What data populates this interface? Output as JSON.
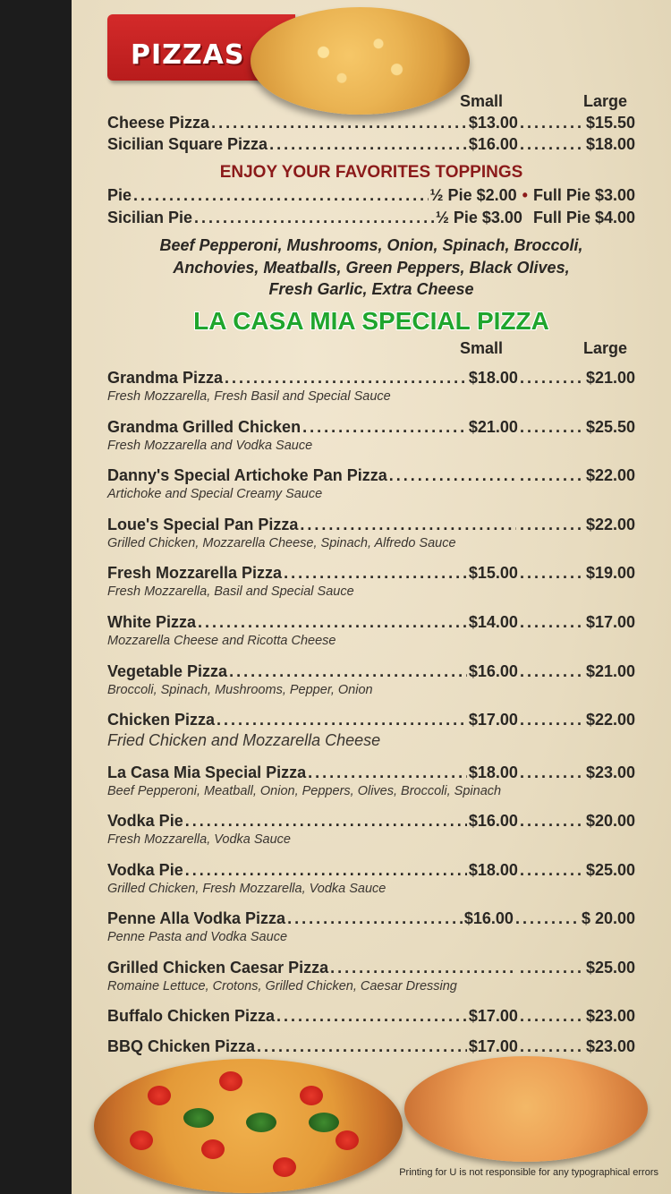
{
  "header": {
    "title": "PIZZAS"
  },
  "pizzas": {
    "col_small": "Small",
    "col_large": "Large",
    "items": [
      {
        "name": "Cheese Pizza",
        "small": "$13.00",
        "large": "$15.50"
      },
      {
        "name": "Sicilian Square Pizza",
        "small": "$16.00",
        "large": "$18.00"
      }
    ]
  },
  "toppings": {
    "heading": "ENJOY YOUR FAVORITES TOPPINGS",
    "prices": [
      {
        "name": "Pie",
        "price1": "½ Pie $2.00",
        "sep": "•",
        "price2": "Full Pie $3.00"
      },
      {
        "name": "Sicilian Pie",
        "price1": "½ Pie $3.00",
        "sep": "",
        "price2": "Full Pie $4.00"
      }
    ],
    "list_line1": "Beef Pepperoni, Mushrooms, Onion, Spinach, Broccoli,",
    "list_line2": "Anchovies, Meatballs, Green Peppers, Black Olives,",
    "list_line3": "Fresh Garlic, Extra Cheese"
  },
  "special": {
    "heading": "LA CASA MIA SPECIAL PIZZA",
    "col_small": "Small",
    "col_large": "Large",
    "items": [
      {
        "name": "Grandma Pizza",
        "small": "$18.00",
        "large": "$21.00",
        "desc": "Fresh Mozzarella, Fresh Basil and Special Sauce"
      },
      {
        "name": "Grandma Grilled Chicken",
        "small": "$21.00",
        "large": "$25.50",
        "desc": "Fresh Mozzarella and Vodka Sauce"
      },
      {
        "name": "Danny's Special Artichoke Pan Pizza",
        "small": "",
        "large": "$22.00",
        "desc": "Artichoke and Special Creamy Sauce"
      },
      {
        "name": "Loue's Special Pan Pizza",
        "small": "",
        "large": "$22.00",
        "desc": "Grilled Chicken, Mozzarella Cheese, Spinach, Alfredo Sauce"
      },
      {
        "name": "Fresh Mozzarella Pizza",
        "small": "$15.00",
        "large": "$19.00",
        "desc": "Fresh Mozzarella, Basil and Special Sauce"
      },
      {
        "name": "White Pizza",
        "small": "$14.00",
        "large": "$17.00",
        "desc": "Mozzarella Cheese and Ricotta Cheese"
      },
      {
        "name": "Vegetable Pizza",
        "small": "$16.00",
        "large": "$21.00",
        "desc": "Broccoli, Spinach, Mushrooms, Pepper, Onion"
      },
      {
        "name": "Chicken Pizza",
        "small": "$17.00",
        "large": "$22.00",
        "desc": "Fried Chicken and Mozzarella Cheese"
      },
      {
        "name": "La Casa Mia Special Pizza",
        "small": "$18.00",
        "large": "$23.00",
        "desc": "Beef Pepperoni, Meatball, Onion, Peppers, Olives, Broccoli, Spinach"
      },
      {
        "name": "Vodka Pie",
        "small": "$16.00",
        "large": "$20.00",
        "desc": "Fresh Mozzarella, Vodka Sauce"
      },
      {
        "name": "Vodka Pie",
        "small": "$18.00",
        "large": "$25.00",
        "desc": "Grilled Chicken, Fresh Mozzarella, Vodka Sauce"
      },
      {
        "name": "Penne Alla Vodka Pizza",
        "small": "$16.00",
        "large": "$ 20.00",
        "desc": "Penne Pasta and Vodka Sauce"
      },
      {
        "name": "Grilled Chicken Caesar Pizza",
        "small": "",
        "large": "$25.00",
        "desc": "Romaine Lettuce, Crotons, Grilled Chicken, Caesar Dressing"
      },
      {
        "name": "Buffalo Chicken Pizza",
        "small": "$17.00",
        "large": "$23.00",
        "desc": ""
      },
      {
        "name": "BBQ Chicken Pizza",
        "small": "$17.00",
        "large": "$23.00",
        "desc": ""
      }
    ]
  },
  "footer": {
    "disclaimer": "Printing for U is not responsible for any typographical errors"
  },
  "colors": {
    "banner_red": "#c62222",
    "special_green": "#1fa52d",
    "toppings_red": "#8b1a1a",
    "paper": "#ebdfc4"
  }
}
